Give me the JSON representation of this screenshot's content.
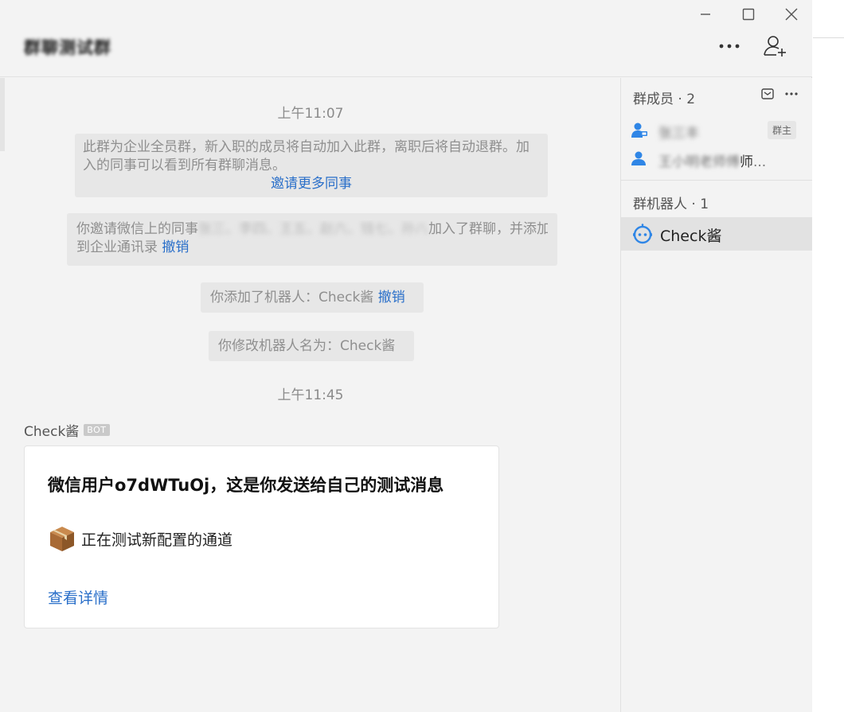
{
  "window": {
    "title": "群聊测试群"
  },
  "icons": {
    "minimize": "minimize-icon",
    "maximize": "maximize-icon",
    "close": "close-icon",
    "more": "more-dots-icon",
    "add_member": "add-user-icon"
  },
  "chat": {
    "time1": "上午11:07",
    "sys1": {
      "text": "此群为企业全员群，新入职的成员将自动加入此群，离职后将自动退群。加入的同事可以看到所有群聊消息。",
      "link": "邀请更多同事"
    },
    "sys2": {
      "prefix": "你邀请微信上的同事",
      "blurred": "张三、李四、王五、赵六、钱七、孙八",
      "suffix": "加入了群聊，并添加",
      "line2": "到企业通讯录",
      "link": "撤销"
    },
    "sys3": {
      "text": "你添加了机器人：Check酱",
      "link": "撤销"
    },
    "sys4": {
      "text": "你修改机器人名为：Check酱"
    },
    "time2": "上午11:45",
    "sender": {
      "name": "Check酱",
      "tag": "BOT"
    },
    "card": {
      "title": "微信用户o7dWTuOj，这是你发送给自己的测试消息",
      "line": "正在测试新配置的通道",
      "link": "查看详情"
    }
  },
  "sidebar": {
    "members_header": "群成员 · 2",
    "members": [
      {
        "name": "张三丰",
        "tag": "群主"
      },
      {
        "name": "王小明老师傅",
        "visible_suffix": "师",
        "ellipsis": "..."
      }
    ],
    "robots_header": "群机器人 · 1",
    "robots": [
      {
        "name": "Check酱"
      }
    ]
  },
  "colors": {
    "accent": "#2a6fc9",
    "background": "#f3f3f3",
    "selected_row": "#e2e2e2"
  }
}
